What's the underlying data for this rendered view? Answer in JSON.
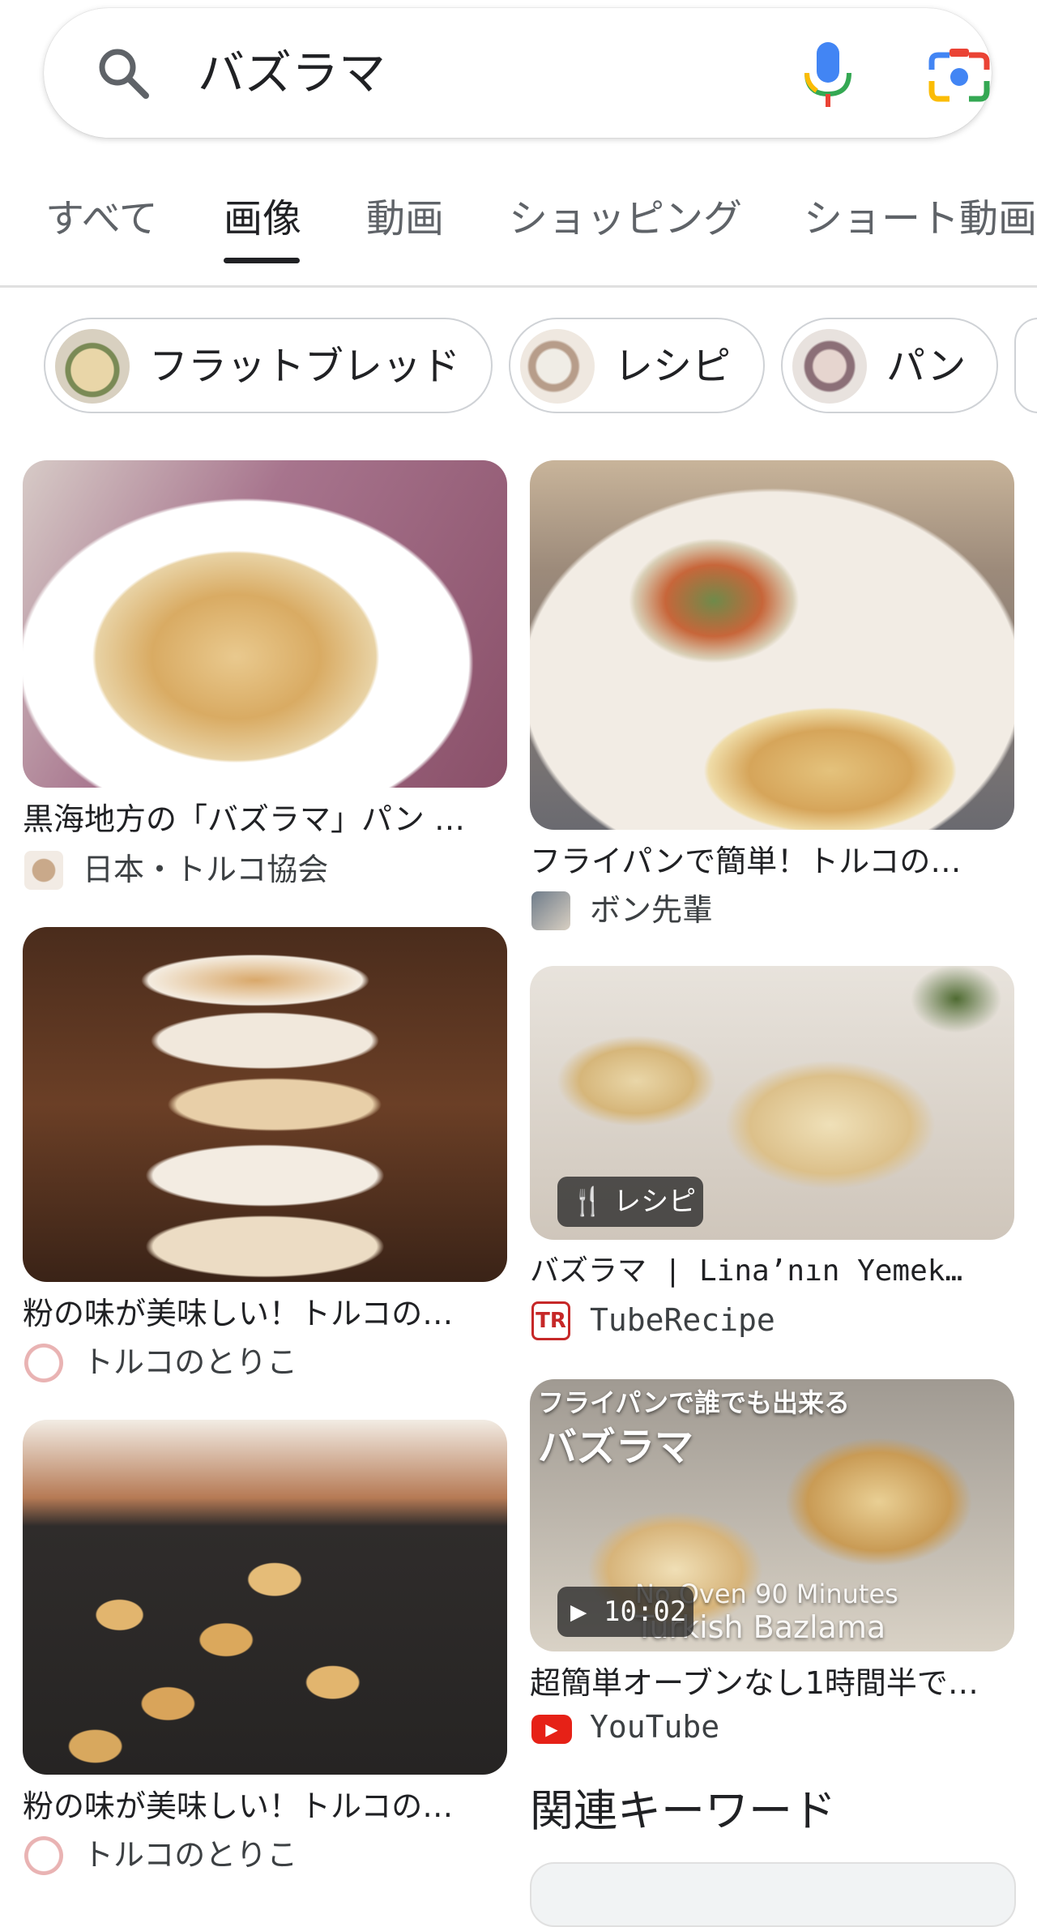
{
  "search": {
    "query": "バズラマ",
    "icons": {
      "search": "search-icon",
      "voice": "mic-icon",
      "lens": "lens-camera-icon"
    }
  },
  "tabs": [
    {
      "label": "すべて",
      "active": false
    },
    {
      "label": "画像",
      "active": true
    },
    {
      "label": "動画",
      "active": false
    },
    {
      "label": "ショッピング",
      "active": false
    },
    {
      "label": "ショート動画",
      "active": false
    }
  ],
  "chips": [
    {
      "label": "フラットブレッド"
    },
    {
      "label": "レシピ"
    },
    {
      "label": "パン"
    }
  ],
  "results": [
    {
      "title": "黒海地方の「バズラマ」パン …",
      "source": "日本・トルコ協会"
    },
    {
      "title": "フライパンで簡単！トルコの…",
      "source": "ボン先輩"
    },
    {
      "title": "粉の味が美味しい！トルコの…",
      "source": "トルコのとりこ"
    },
    {
      "title": "バズラマ | Lina’nın Yemek…",
      "source": "TubeRecipe",
      "badge": "レシピ"
    },
    {
      "title": "粉の味が美味しい！トルコの…",
      "source": "トルコのとりこ"
    },
    {
      "title": "超簡単オーブンなし1時間半で…",
      "source": "YouTube",
      "badge": "10:02",
      "overlay_line1": "フライパンで誰でも出来る",
      "overlay_line2": "バズラマ",
      "overlay_line3": "No Oven 90 Minutes",
      "overlay_line4": "Turkish Bazlama"
    }
  ],
  "related": {
    "title": "関連キーワード"
  },
  "colors": {
    "accent": "#202124",
    "muted": "#5f6368",
    "youtube": "#e62117",
    "tuberecipe": "#c62828"
  }
}
